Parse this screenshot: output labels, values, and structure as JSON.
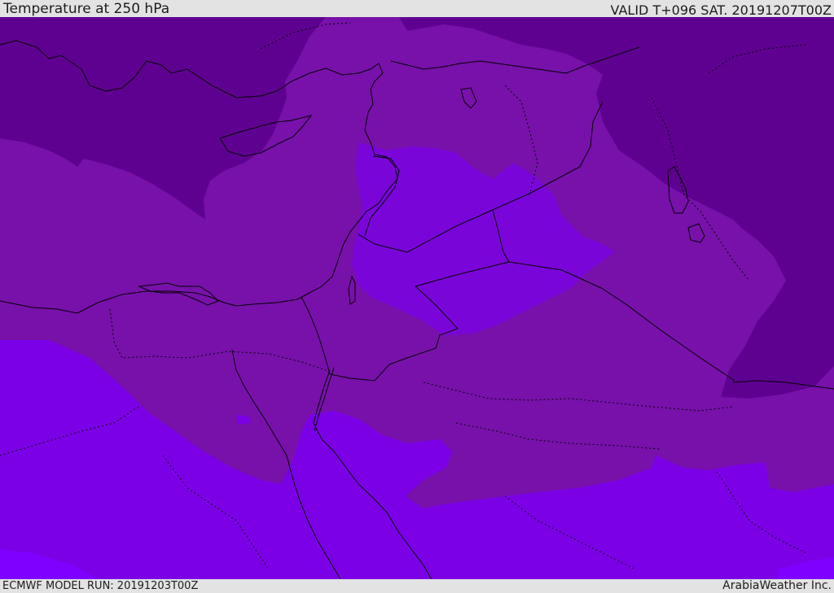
{
  "header": {
    "title": "Temperature at 250 hPa",
    "valid": "VALID T+096 SAT. 20191207T00Z"
  },
  "footer": {
    "model_run": "ECMWF MODEL RUN: 20191203T00Z",
    "brand": "ArabiaWeather Inc."
  },
  "map": {
    "variable": "temperature",
    "level": "250 hPa",
    "colors": {
      "coldest": "#5f0190",
      "cold": "#7711aa",
      "mild": "#7a05d9",
      "warm": "#7c00e6",
      "warmest": "#7f00ff",
      "boundary": "#000000"
    }
  }
}
